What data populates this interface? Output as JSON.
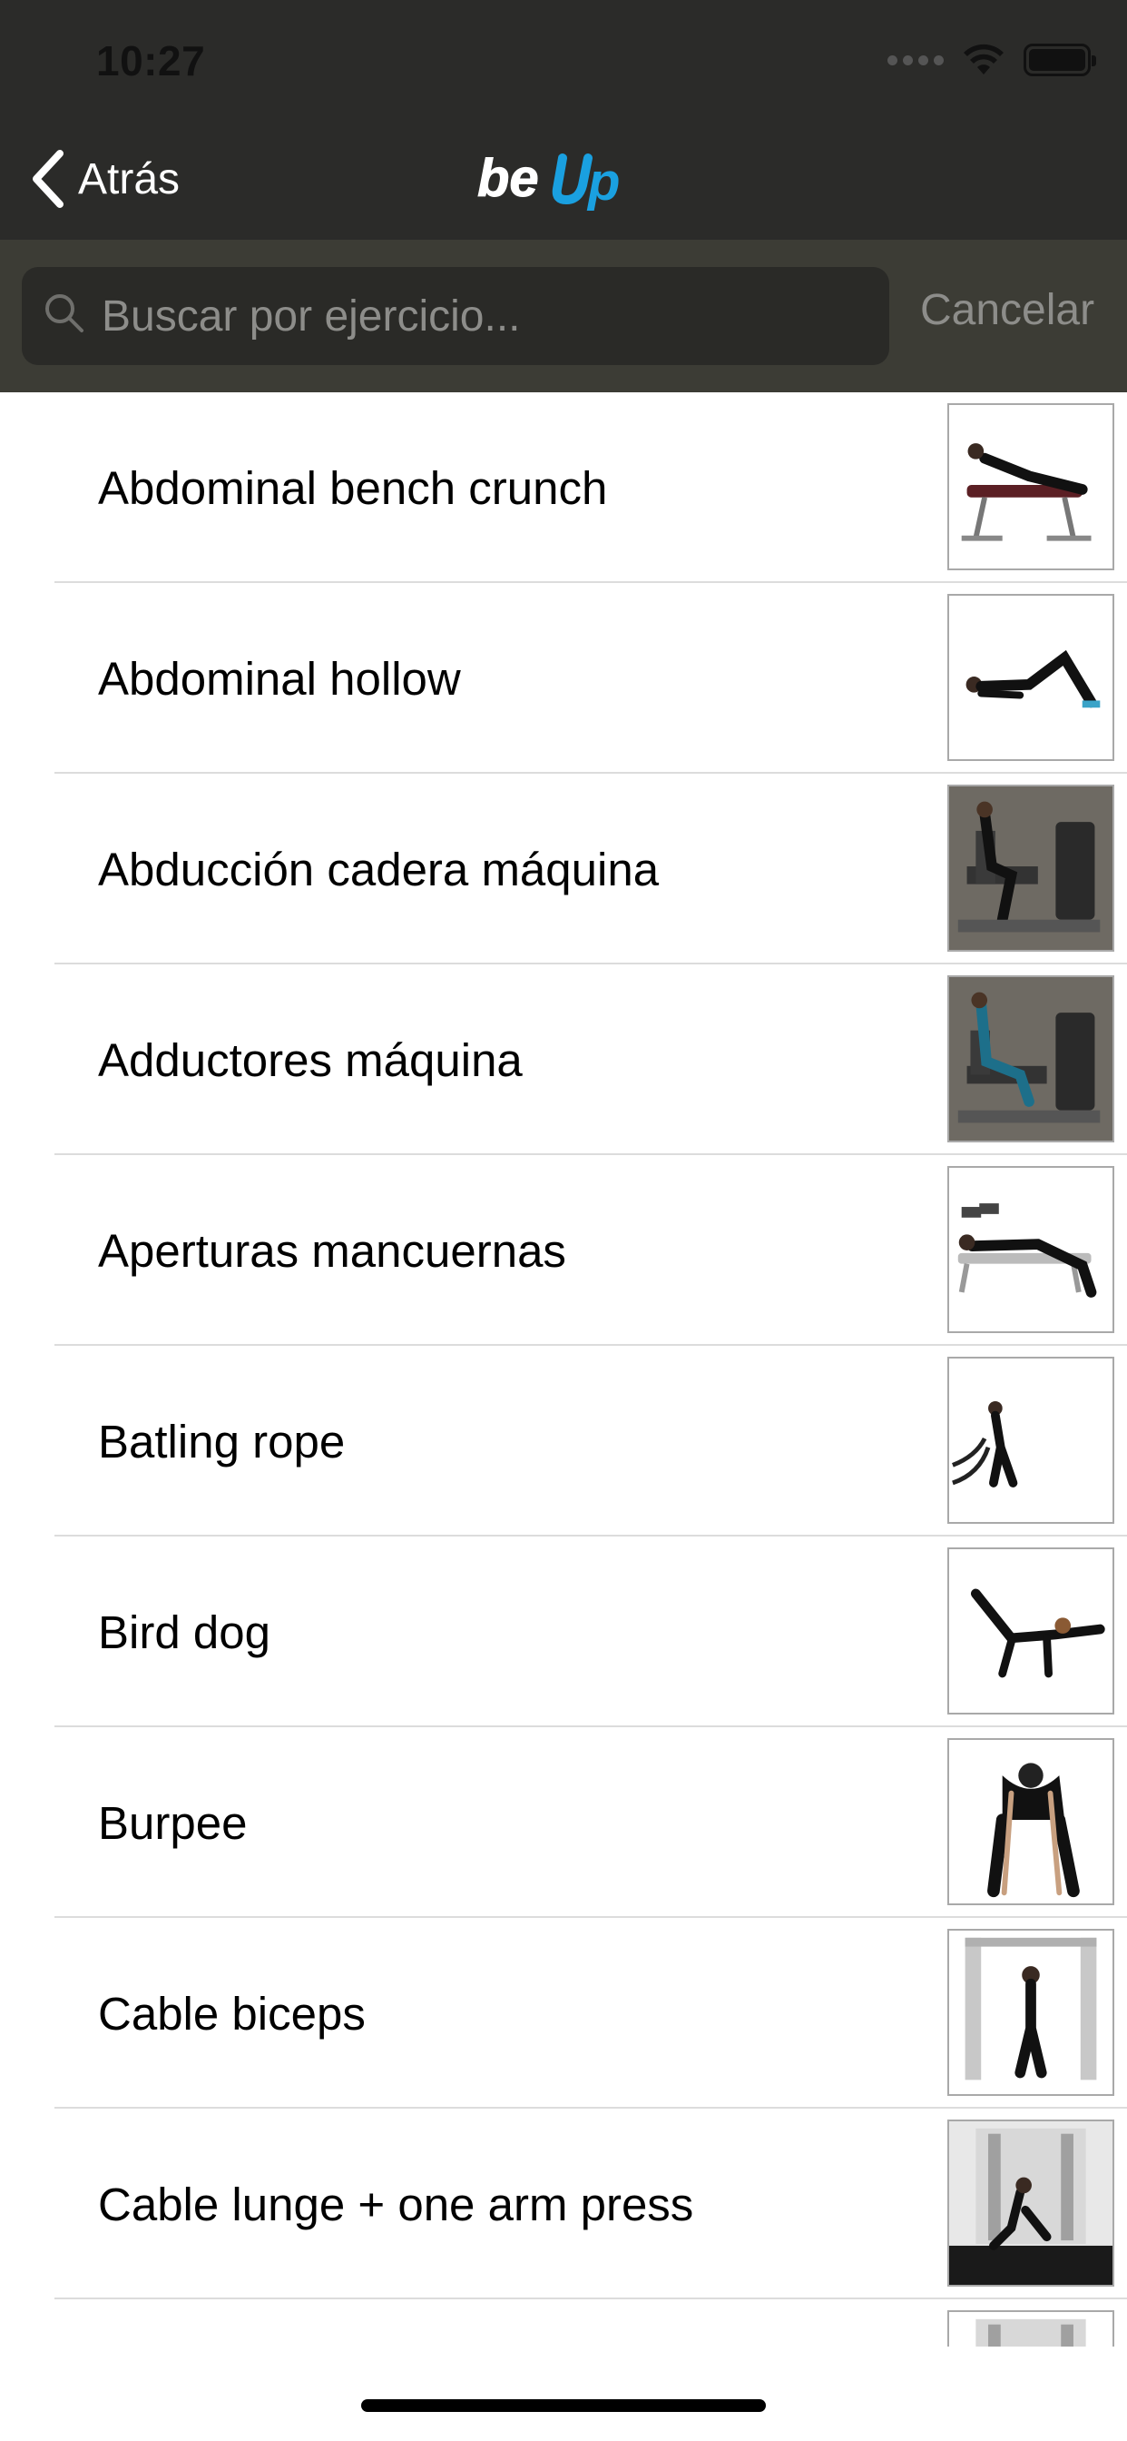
{
  "status_bar": {
    "time": "10:27"
  },
  "nav": {
    "back_label": "Atrás",
    "logo_text": "beUp"
  },
  "search": {
    "placeholder": "Buscar por ejercicio...",
    "value": "",
    "cancel_label": "Cancelar"
  },
  "exercises": [
    {
      "name": "Abdominal bench crunch",
      "thumb_bg": "#ffffff"
    },
    {
      "name": "Abdominal hollow",
      "thumb_bg": "#ffffff"
    },
    {
      "name": "Abducción cadera máquina",
      "thumb_bg": "#6e6a63"
    },
    {
      "name": "Adductores máquina",
      "thumb_bg": "#6e6a63"
    },
    {
      "name": "Aperturas mancuernas",
      "thumb_bg": "#ffffff"
    },
    {
      "name": "Batling rope",
      "thumb_bg": "#ffffff"
    },
    {
      "name": "Bird dog",
      "thumb_bg": "#ffffff"
    },
    {
      "name": "Burpee",
      "thumb_bg": "#ffffff"
    },
    {
      "name": "Cable biceps",
      "thumb_bg": "#ffffff"
    },
    {
      "name": "Cable lunge + one arm press",
      "thumb_bg": "#e8e8e8"
    },
    {
      "name": "",
      "thumb_bg": "#ffffff"
    }
  ],
  "colors": {
    "header_bg": "#2b2b29",
    "search_area_bg": "#3c3c35",
    "logo_accent": "#1aa0e0"
  }
}
